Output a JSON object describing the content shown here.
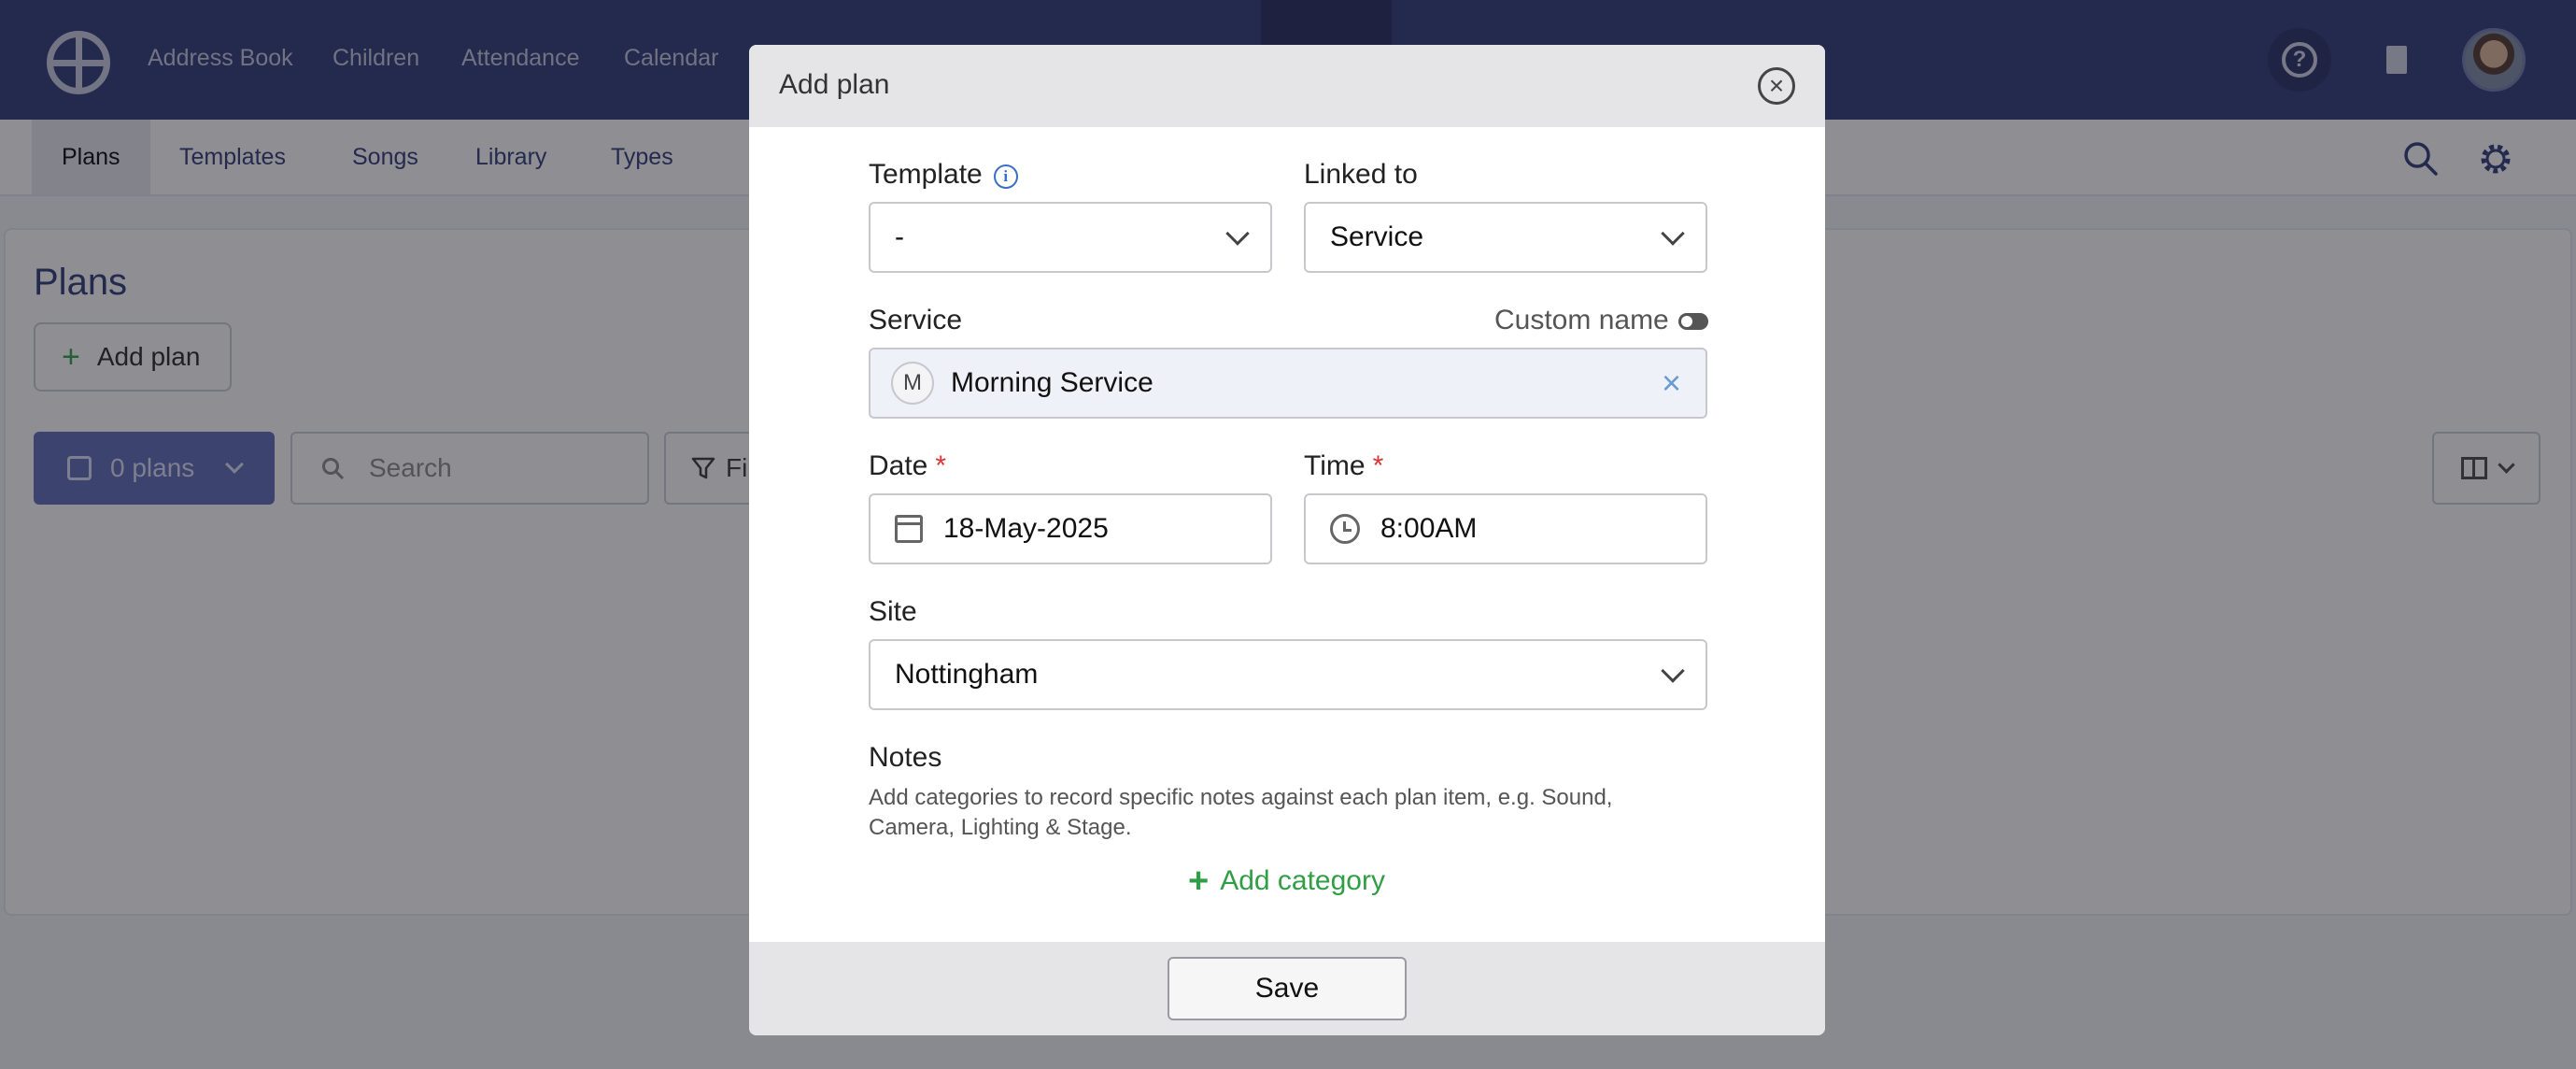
{
  "topnav": {
    "items": [
      "Address Book",
      "Children",
      "Attendance",
      "Calendar"
    ],
    "help_icon": "question-circle-icon",
    "org_icon": "building-icon"
  },
  "subnav": {
    "tabs": [
      "Plans",
      "Templates",
      "Songs",
      "Library",
      "Types"
    ],
    "active": "Plans"
  },
  "page": {
    "title": "Plans",
    "add_plan_label": "Add plan",
    "plans_count_label": "0 plans",
    "search_placeholder": "Search",
    "filter_label": "Fi"
  },
  "modal": {
    "title": "Add plan",
    "template": {
      "label": "Template",
      "value": "-"
    },
    "linked_to": {
      "label": "Linked to",
      "value": "Service"
    },
    "service": {
      "label": "Service",
      "custom_name_label": "Custom name",
      "badge": "M",
      "value": "Morning Service"
    },
    "date": {
      "label": "Date",
      "required_mark": "*",
      "value": "18-May-2025"
    },
    "time": {
      "label": "Time",
      "required_mark": "*",
      "value": "8:00AM"
    },
    "site": {
      "label": "Site",
      "value": "Nottingham"
    },
    "notes": {
      "label": "Notes",
      "help": "Add categories to record specific notes against each plan item, e.g. Sound, Camera, Lighting & Stage.",
      "add_category_label": "Add category"
    },
    "save_label": "Save"
  },
  "colors": {
    "nav_bg": "#2b3575",
    "accent_green": "#2f9e44",
    "primary_button": "#5c68b6",
    "required_red": "#dd3333"
  }
}
